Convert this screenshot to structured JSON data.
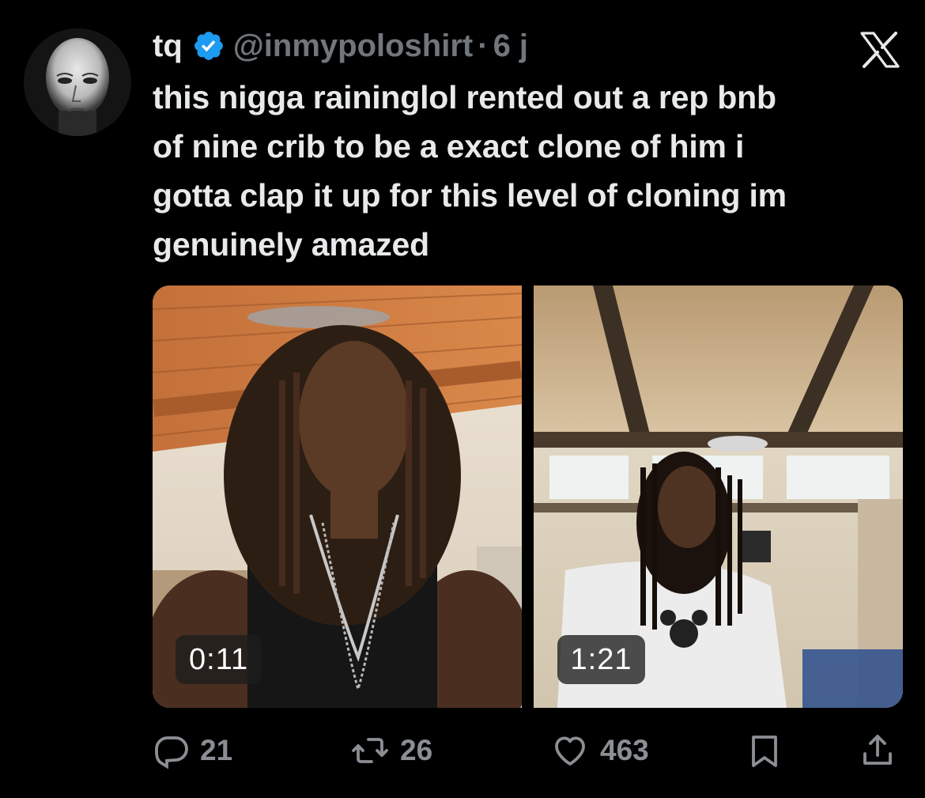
{
  "author": {
    "display_name": "tq",
    "handle": "@inmypoloshirt",
    "separator": "·",
    "timestamp": "6 j",
    "verified": true,
    "avatar_icon": "avatar-portrait"
  },
  "brand": {
    "logo": "x-logo"
  },
  "tweet": {
    "text": "this nigga raininglol rented out a rep bnb\nof nine crib to be a exact clone of him i\ngotta clap it up for this level of cloning im\ngenuinely amazed"
  },
  "media": {
    "videos": [
      {
        "duration": "0:11"
      },
      {
        "duration": "1:21"
      }
    ]
  },
  "actions": {
    "replies": "21",
    "reposts": "26",
    "likes": "463",
    "icons": [
      "reply-icon",
      "repost-icon",
      "like-icon",
      "bookmark-icon",
      "share-icon"
    ]
  },
  "colors": {
    "background": "#000000",
    "text": "#e7e9ea",
    "muted": "#71767b",
    "verified": "#1d9bf0"
  }
}
